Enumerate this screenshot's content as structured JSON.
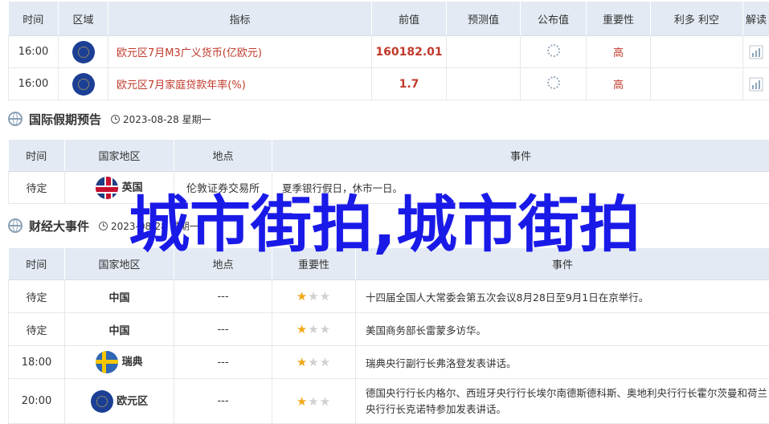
{
  "indicators": {
    "headers": [
      "时间",
      "区域",
      "指标",
      "前值",
      "预测值",
      "公布值",
      "重要性",
      "利多 利空",
      "解读"
    ],
    "rows": [
      {
        "time": "16:00",
        "region_flag": "eu",
        "name": "欧元区7月M3广义货币(亿欧元)",
        "prev": "160182.01",
        "forecast": "",
        "actual_icon": "loading-icon",
        "importance": "高",
        "effect": ""
      },
      {
        "time": "16:00",
        "region_flag": "eu",
        "name": "欧元区7月家庭贷款年率(%)",
        "prev": "1.7",
        "forecast": "",
        "actual_icon": "loading-icon",
        "importance": "高",
        "effect": ""
      }
    ]
  },
  "holidays": {
    "title": "国际假期预告",
    "date": "2023-08-28 星期一",
    "headers": [
      "时间",
      "国家地区",
      "地点",
      "事件"
    ],
    "rows": [
      {
        "time": "待定",
        "flag": "uk",
        "country": "英国",
        "place": "伦敦证券交易所",
        "event": "夏季银行假日，休市一日。"
      }
    ]
  },
  "events": {
    "title": "财经大事件",
    "date": "2023-08-28 星期一",
    "headers": [
      "时间",
      "国家地区",
      "地点",
      "重要性",
      "事件"
    ],
    "rows": [
      {
        "time": "待定",
        "flag": "",
        "country": "中国",
        "place": "---",
        "stars": 1,
        "event": "十四届全国人大常委会第五次会议8月28日至9月1日在京举行。"
      },
      {
        "time": "待定",
        "flag": "",
        "country": "中国",
        "place": "---",
        "stars": 1,
        "event": "美国商务部长雷蒙多访华。"
      },
      {
        "time": "18:00",
        "flag": "se",
        "country": "瑞典",
        "place": "---",
        "stars": 1,
        "event": "瑞典央行副行长弗洛登发表讲话。"
      },
      {
        "time": "20:00",
        "flag": "eu",
        "country": "欧元区",
        "place": "---",
        "stars": 1,
        "event": "德国央行行长内格尔、西班牙央行行长埃尔南德斯德科斯、奥地利央行行长霍尔茨曼和荷兰央行行长克诺特参加发表讲话。"
      }
    ]
  },
  "overlay_text": "城市街拍,城市街拍",
  "colors": {
    "accent_red": "#c0392b",
    "header_bg": "#e3eaf3",
    "overlay_blue": "#1a1ae8",
    "star_on": "#f0a818"
  }
}
